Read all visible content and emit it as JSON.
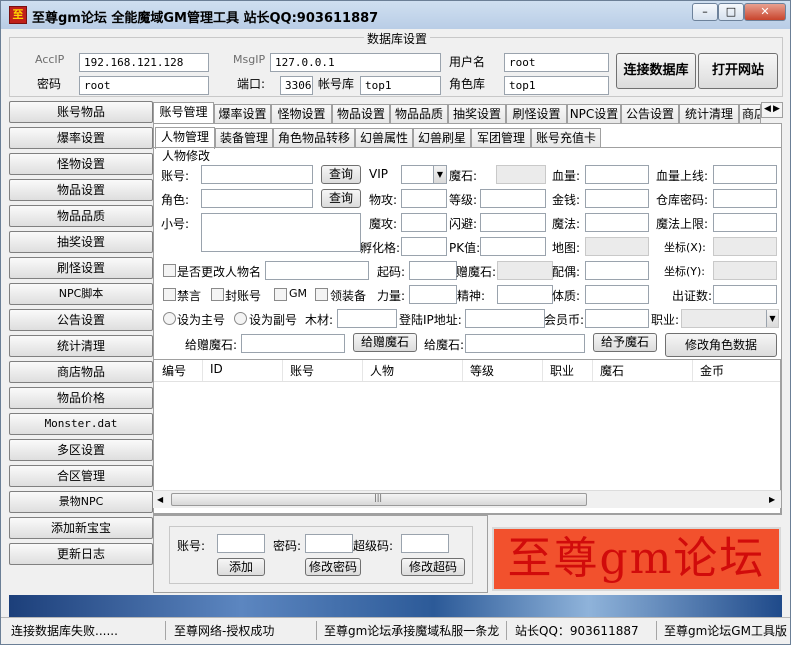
{
  "window": {
    "title": "至尊gm论坛 全能魔域GM管理工具 站长QQ:903611887",
    "icon_text": "至",
    "controls": [
      "–",
      "□",
      "✕"
    ]
  },
  "db": {
    "group_title": "数据库设置",
    "accip_label": "AccIP",
    "accip_value": "192.168.121.128",
    "msgip_label": "MsgIP",
    "msgip_value": "127.0.0.1",
    "user_label": "用户名",
    "user_value": "root",
    "pwd_label": "密码",
    "pwd_value": "root",
    "port_label": "端口:",
    "port_value": "3306",
    "accdb_label": "帐号库",
    "accdb_value": "top1",
    "roledb_label": "角色库",
    "roledb_value": "top1",
    "connect_btn": "连接数据库",
    "open_site_btn": "打开网站"
  },
  "sidebar": {
    "items": [
      "账号物品",
      "爆率设置",
      "怪物设置",
      "物品设置",
      "物品品质",
      "抽奖设置",
      "刷怪设置",
      "NPC脚本",
      "公告设置",
      "统计清理",
      "商店物品",
      "物品价格",
      "Monster.dat",
      "多区设置",
      "合区管理",
      "景物NPC",
      "添加新宝宝",
      "更新日志"
    ]
  },
  "tabs": {
    "main": [
      "账号管理",
      "爆率设置",
      "怪物设置",
      "物品设置",
      "物品品质",
      "抽奖设置",
      "刷怪设置",
      "NPC设置",
      "公告设置",
      "统计清理",
      "商店物品"
    ],
    "sub": [
      "人物管理",
      "装备管理",
      "角色物品转移",
      "幻兽属性",
      "幻兽刷星",
      "军团管理",
      "账号充值卡"
    ]
  },
  "form": {
    "group_title": "人物修改",
    "account": "账号:",
    "role": "角色:",
    "alt": "小号:",
    "query1": "查询",
    "query2": "查询",
    "vip": "VIP",
    "magic_stone": "魔石:",
    "hp": "血量:",
    "hp_max": "血量上线:",
    "phys_atk": "物攻:",
    "level": "等级:",
    "gold": "金钱:",
    "warehouse_pwd": "仓库密码:",
    "mag_atk": "魔攻:",
    "dodge": "闪避:",
    "mana": "魔法:",
    "mana_max": "魔法上限:",
    "hatch": "孵化格:",
    "pk": "PK值:",
    "map": "地图:",
    "coord_x": "坐标(X):",
    "change_name": "是否更改人物名",
    "start_code": "起码:",
    "gift_stone": "赠魔石:",
    "mate": "配偶:",
    "coord_y": "坐标(Y):",
    "ban_talk": "禁言",
    "ban_account": "封账号",
    "gm": "GM",
    "get_equip": "领装备",
    "strength": "力量:",
    "spirit": "精神:",
    "constitution": "体质:",
    "cert_count": "出证数:",
    "set_main": "设为主号",
    "set_alt": "设为副号",
    "wood": "木材:",
    "login_ip": "登陆IP地址:",
    "member_coin": "会员币:",
    "profession": "职业:",
    "gift_stone2": "给赠魔石:",
    "give_gift_btn": "给赠魔石",
    "magic_stone2": "给魔石:",
    "give_stone_btn": "给予魔石",
    "modify_btn": "修改角色数据"
  },
  "grid": {
    "columns": [
      "编号",
      "ID",
      "账号",
      "人物",
      "等级",
      "职业",
      "魔石",
      "金币"
    ]
  },
  "account_box": {
    "account": "账号:",
    "password": "密码:",
    "super_code": "超级码:",
    "add_btn": "添加",
    "modify_pwd_btn": "修改密码",
    "modify_code_btn": "修改超码"
  },
  "logo_text": "至尊gm论坛",
  "statusbar": [
    "连接数据库失败......",
    "至尊网络-授权成功",
    "至尊gm论坛承接魔域私服一条龙",
    "站长QQ：903611887",
    "至尊gm论坛GM工具版"
  ]
}
